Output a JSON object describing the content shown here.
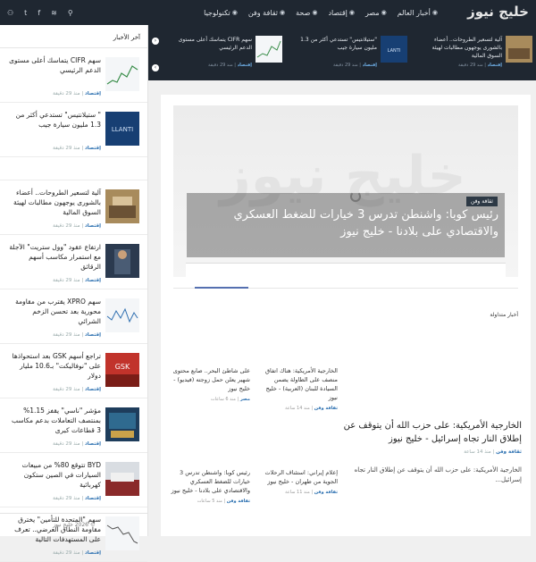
{
  "header": {
    "logo": "خليج نيوز",
    "nav": [
      "أخبار العالم",
      "مصر",
      "إقتصاد",
      "صحة",
      "ثقافة وفن",
      "تكنولوجيا"
    ],
    "social": [
      "user-icon",
      "twitter-icon",
      "facebook-icon",
      "rss-icon",
      "search-icon"
    ]
  },
  "sidebar": {
    "heading": "آخر الأخبار",
    "items": [
      {
        "title": "سهم CIFR يتماسك أعلى مستوى الدعم الرئيسي",
        "category": "إقتصاد",
        "time": "منذ 29 دقيقة"
      },
      {
        "title": "\" ستيلانتيس\" تستدعي أكثر من 1.3 مليون سيارة جيب",
        "category": "إقتصاد",
        "time": "منذ 29 دقيقة"
      },
      {
        "title": "",
        "category": "",
        "time": ""
      },
      {
        "title": "آلية لتسعير الطروحات.. أعضاء بالشورى يوجهون مطالبات لهيئة السوق المالية",
        "category": "إقتصاد",
        "time": "منذ 29 دقيقة"
      },
      {
        "title": "ارتفاع عقود \"وول ستريت\" الآجلة مع استمرار مكاسب أسهم الرقائق",
        "category": "إقتصاد",
        "time": "منذ 29 دقيقة"
      },
      {
        "title": "سهم XPRO يقترب من مقاومة محورية بعد تحسن الزخم الشرائي",
        "category": "إقتصاد",
        "time": "منذ 29 دقيقة"
      },
      {
        "title": "تراجع أسهم GSK بعد استحواذها على \"نوفاليكت\" بـ10.6 مليار دولار",
        "category": "إقتصاد",
        "time": "منذ 29 دقيقة"
      },
      {
        "title": "مؤشر \"ناسي\" يقفز 1.15% بمنتصف التعاملات بدعم مكاسب 3 قطاعات كبرى",
        "category": "إقتصاد",
        "time": "منذ 29 دقيقة"
      },
      {
        "title": "BYD تتوقع 80% من مبيعات السيارات في الصين ستكون كهربائية",
        "category": "إقتصاد",
        "time": "منذ 29 دقيقة"
      },
      {
        "title": "سهم \"المتحدة للتأمين\" يخترق مقاومة النطاق العرضي.. تعرف على المستهدفات التالية",
        "category": "إقتصاد",
        "time": "منذ 29 دقيقة"
      }
    ],
    "footer": "© 2026 خليج نيوز"
  },
  "ticker": {
    "items": [
      {
        "title": "آلية لتسعير الطروحات.. أعضاء بالشورى يوجهون مطالبات لهيئة السوق المالية",
        "category": "إقتصاد",
        "time": "منذ 29 دقيقة"
      },
      {
        "title": "\"ستيلانتيس\" تستدعي أكثر من 1.3 مليون سيارة جيب",
        "category": "إقتصاد",
        "time": "منذ 29 دقيقة"
      },
      {
        "title": "سهم CIFR يتماسك أعلى مستوى الدعم الرئيسي",
        "category": "إقتصاد",
        "time": "منذ 29 دقيقة"
      }
    ]
  },
  "hero": {
    "category": "ثقافة وفن",
    "headline": "رئيس كوبا: واشنطن تدرس 3 خيارات للضغط العسكري والاقتصادي على بلادنا - خليج نيوز",
    "ghost": "خليج نيوز"
  },
  "trending": {
    "label": "أخبار متداولة",
    "big": {
      "title": "الخارجية الأمريكية: على حزب الله أن يتوقف عن إطلاق النار تجاه إسرائيل - خليج نيوز",
      "category": "ثقافة وفن",
      "time": "منذ 14 ساعة",
      "excerpt": "الخارجية الأمريكية: على حزب الله أن يتوقف عن إطلاق النار تجاه إسرائيل..."
    },
    "cards": [
      {
        "title": "الخارجية الأمريكية: هناك اتفاق منصف على الطاولة يضمن السيادة للبنان (العربية) - خليج نيوز",
        "category": "ثقافة وفن",
        "time": "منذ 14 ساعة"
      },
      {
        "title": "على شاطئ البحر.. صابع محتوى شهير يعلن حمل زوجته (فيديو) - خليج نيوز",
        "category": "مصر",
        "time": "منذ 6 ساعات"
      },
      {
        "title": "إعلام إيراني: استئناف الرحلات الجوية من طهران - خليج نيوز",
        "category": "ثقافة وفن",
        "time": "منذ 11 ساعة"
      },
      {
        "title": "رئيس كوبا: واشنطن تدرس 3 خيارات للضغط العسكري والاقتصادي على بلادنا - خليج نيوز",
        "category": "ثقافة وفن",
        "time": "منذ 5 ساعات"
      }
    ]
  }
}
